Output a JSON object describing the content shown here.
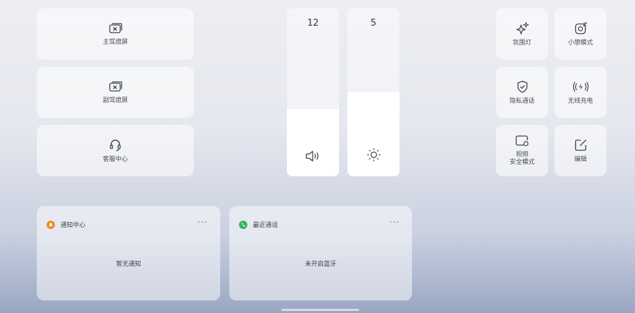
{
  "left_tiles": [
    {
      "label": "主驾熄屏",
      "icon": "screen-off-icon"
    },
    {
      "label": "副驾熄屏",
      "icon": "screen-off-icon"
    },
    {
      "label": "客服中心",
      "icon": "headset-icon"
    }
  ],
  "sliders": {
    "volume": {
      "value": "12",
      "level": 0.46,
      "icon": "speaker-icon"
    },
    "brightness": {
      "value": "5",
      "level": 0.6,
      "icon": "sun-icon"
    }
  },
  "right_tiles": [
    {
      "label": "氛围灯",
      "icon": "sparkle-icon"
    },
    {
      "label": "小憩模式",
      "icon": "nap-icon"
    },
    {
      "label": "隐私通话",
      "icon": "shield-check-icon"
    },
    {
      "label": "无线充电",
      "icon": "wireless-charge-icon"
    },
    {
      "label": "视频\n安全模式",
      "icon": "video-safe-icon"
    },
    {
      "label": "编辑",
      "icon": "edit-icon"
    }
  ],
  "cards": {
    "notifications": {
      "title": "通知中心",
      "more": "···",
      "body": "暂无通知",
      "dot_color": "#f08a24"
    },
    "recent_calls": {
      "title": "最近通话",
      "more": "···",
      "body": "未开启蓝牙",
      "dot_color": "#2db55d"
    }
  }
}
